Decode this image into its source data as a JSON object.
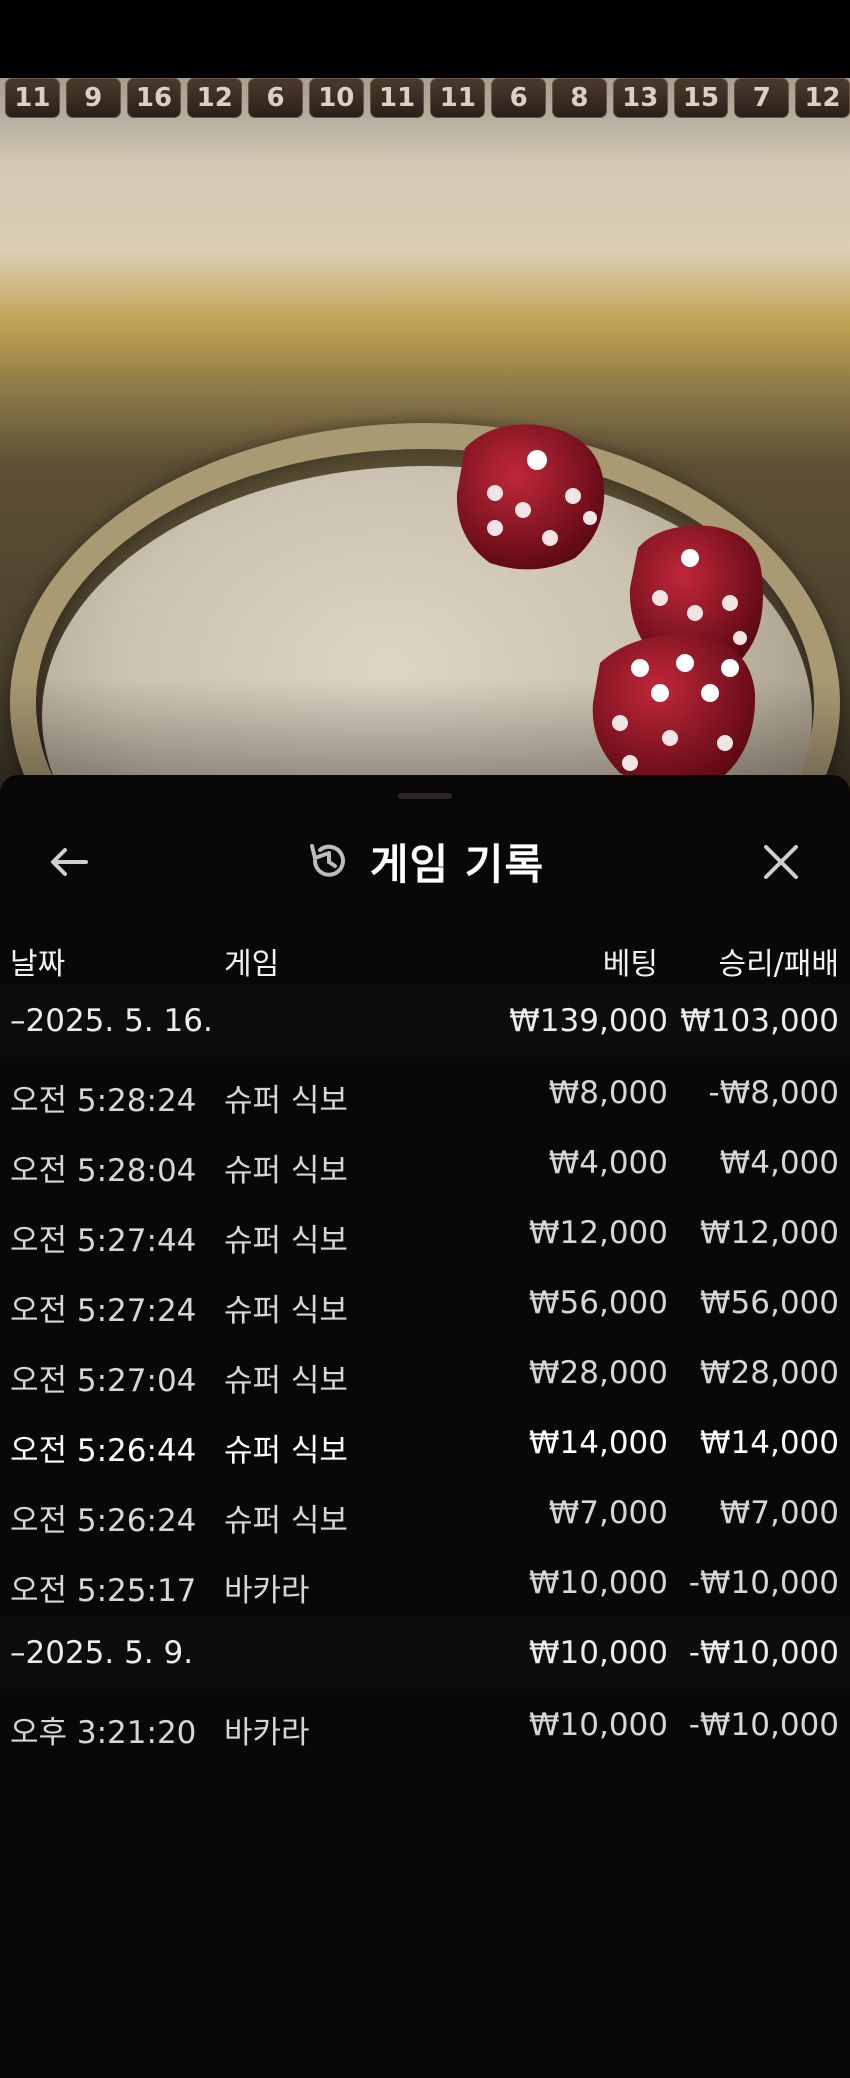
{
  "recent_results": [
    11,
    9,
    16,
    12,
    6,
    10,
    11,
    11,
    6,
    8,
    13,
    15,
    7,
    12
  ],
  "panel": {
    "title": "게임 기록",
    "icons": {
      "back": "arrow-left-icon",
      "history": "history-icon",
      "close": "close-icon"
    },
    "columns": {
      "date": "날짜",
      "game": "게임",
      "bet": "베팅",
      "result": "승리/패배"
    },
    "rows": [
      {
        "kind": "group",
        "date": "–2025. 5. 16.",
        "game": "",
        "bet": "₩139,000",
        "result": "₩103,000"
      },
      {
        "kind": "item",
        "date": "오전 5:28:24",
        "game": "슈퍼 식보",
        "bet": "₩8,000",
        "result": "-₩8,000"
      },
      {
        "kind": "item",
        "date": "오전 5:28:04",
        "game": "슈퍼 식보",
        "bet": "₩4,000",
        "result": "₩4,000"
      },
      {
        "kind": "item",
        "date": "오전 5:27:44",
        "game": "슈퍼 식보",
        "bet": "₩12,000",
        "result": "₩12,000"
      },
      {
        "kind": "item",
        "date": "오전 5:27:24",
        "game": "슈퍼 식보",
        "bet": "₩56,000",
        "result": "₩56,000"
      },
      {
        "kind": "item",
        "date": "오전 5:27:04",
        "game": "슈퍼 식보",
        "bet": "₩28,000",
        "result": "₩28,000"
      },
      {
        "kind": "item",
        "date": "오전 5:26:44",
        "game": "슈퍼 식보",
        "bet": "₩14,000",
        "result": "₩14,000"
      },
      {
        "kind": "item",
        "date": "오전 5:26:24",
        "game": "슈퍼 식보",
        "bet": "₩7,000",
        "result": "₩7,000"
      },
      {
        "kind": "item",
        "date": "오전 5:25:17",
        "game": "바카라",
        "bet": "₩10,000",
        "result": "-₩10,000"
      },
      {
        "kind": "group",
        "date": "–2025. 5. 9.",
        "game": "",
        "bet": "₩10,000",
        "result": "-₩10,000"
      },
      {
        "kind": "item",
        "date": "오후 3:21:20",
        "game": "바카라",
        "bet": "₩10,000",
        "result": "-₩10,000"
      }
    ]
  },
  "colors": {
    "panel_bg": "#0a0708",
    "text": "#e8e8e8",
    "die": "#8c0f1c"
  }
}
